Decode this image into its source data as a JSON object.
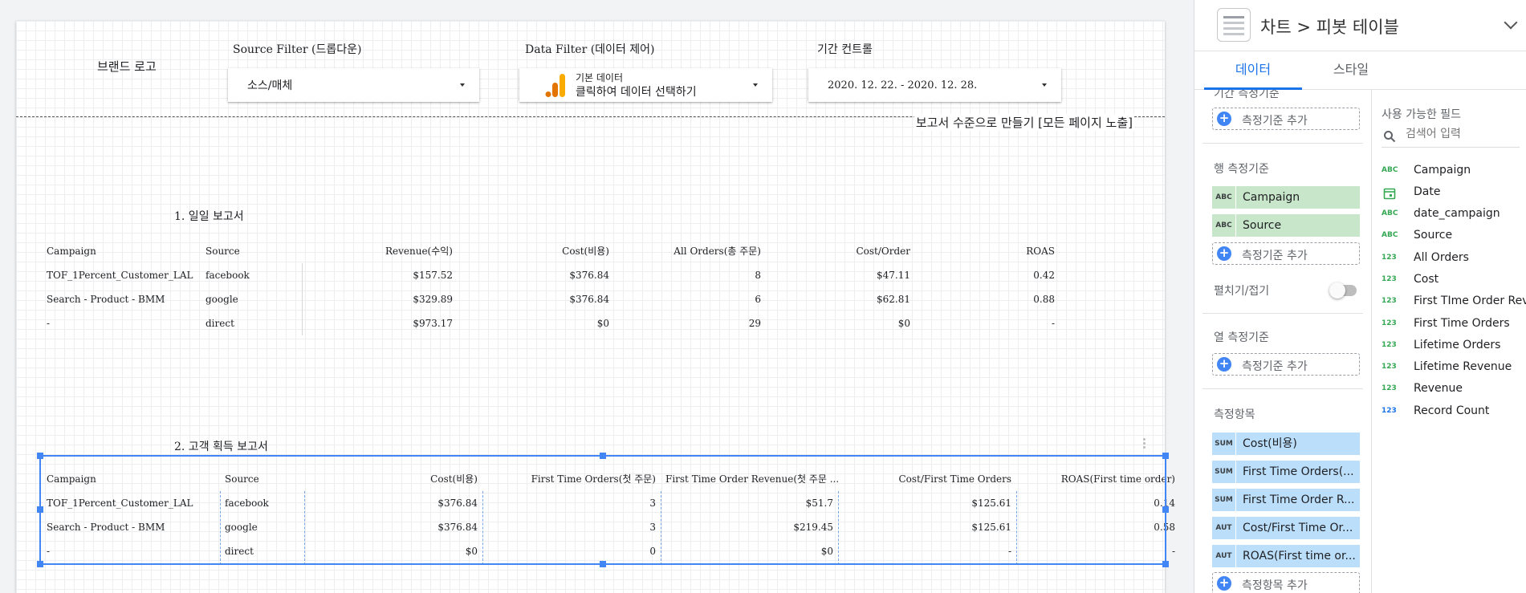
{
  "canvas": {
    "brand_logo": "브랜드 로고",
    "source_filter": {
      "title": "Source Filter (드롭다운)",
      "value": "소스/매체"
    },
    "data_filter": {
      "title": "Data Filter (데이터 제어)",
      "line1": "기본 데이터",
      "line2": "클릭하여 데이터 선택하기"
    },
    "date_control": {
      "title": "기간 컨트롤",
      "value": "2020. 12. 22. - 2020. 12. 28."
    },
    "report_level_note": "보고서 수준으로 만들기 [모든 페이지 노출]",
    "table1": {
      "title": "1. 일일 보고서",
      "columns": [
        "Campaign",
        "Source",
        "Revenue(수익)",
        "Cost(비용)",
        "All Orders(총 주문)",
        "Cost/Order",
        "ROAS"
      ],
      "rows": [
        [
          "TOF_1Percent_Customer_LAL",
          "facebook",
          "$157.52",
          "$376.84",
          "8",
          "$47.11",
          "0.42"
        ],
        [
          "Search - Product - BMM",
          "google",
          "$329.89",
          "$376.84",
          "6",
          "$62.81",
          "0.88"
        ],
        [
          "-",
          "direct",
          "$973.17",
          "$0",
          "29",
          "$0",
          "-"
        ]
      ]
    },
    "table2": {
      "title": "2. 고객 획득 보고서",
      "columns": [
        "Campaign",
        "Source",
        "Cost(비용)",
        "First Time Orders(첫 주문)",
        "First Time Order Revenue(첫 주문 ...",
        "Cost/First Time Orders",
        "ROAS(First time order)"
      ],
      "rows": [
        [
          "TOF_1Percent_Customer_LAL",
          "facebook",
          "$376.84",
          "3",
          "$51.7",
          "$125.61",
          "0.14"
        ],
        [
          "Search - Product - BMM",
          "google",
          "$376.84",
          "3",
          "$219.45",
          "$125.61",
          "0.58"
        ],
        [
          "-",
          "direct",
          "$0",
          "0",
          "$0",
          "-",
          "-"
        ]
      ]
    }
  },
  "panel": {
    "header_title": "차트 > 피봇 테이블",
    "tabs": [
      "데이터",
      "스타일"
    ],
    "period_dimension": {
      "heading": "기간 측정기준",
      "add_label": "측정기준 추가"
    },
    "row_dimensions": {
      "heading": "행 측정기준",
      "chips": [
        {
          "badge": "ABC",
          "name": "Campaign"
        },
        {
          "badge": "ABC",
          "name": "Source"
        }
      ],
      "add_label": "측정기준 추가"
    },
    "expand_collapse": {
      "label": "펼치기/접기",
      "enabled": false
    },
    "column_dimensions": {
      "heading": "열 측정기준",
      "add_label": "측정기준 추가"
    },
    "metrics": {
      "heading": "측정항목",
      "chips": [
        {
          "badge": "SUM",
          "name": "Cost(비용)"
        },
        {
          "badge": "SUM",
          "name": "First Time Orders(..."
        },
        {
          "badge": "SUM",
          "name": "First Time Order R..."
        },
        {
          "badge": "AUT",
          "name": "Cost/First Time Or..."
        },
        {
          "badge": "AUT",
          "name": "ROAS(First time or..."
        }
      ],
      "add_label": "측정항목 추가"
    },
    "available_fields": {
      "heading": "사용 가능한 필드",
      "search_placeholder": "검색어 입력",
      "fields": [
        {
          "type": "ABC",
          "name": "Campaign"
        },
        {
          "type": "date",
          "name": "Date"
        },
        {
          "type": "ABC",
          "name": "date_campaign"
        },
        {
          "type": "ABC",
          "name": "Source"
        },
        {
          "type": "123",
          "name": "All Orders"
        },
        {
          "type": "123",
          "name": "Cost"
        },
        {
          "type": "123",
          "name": "First TIme Order Reve..."
        },
        {
          "type": "123",
          "name": "First Time Orders"
        },
        {
          "type": "123",
          "name": "Lifetime Orders"
        },
        {
          "type": "123",
          "name": "Lifetime Revenue"
        },
        {
          "type": "123",
          "name": "Revenue"
        },
        {
          "type": "123",
          "name": "Record Count"
        }
      ]
    }
  },
  "colors": {
    "accent": "#1a73e8",
    "selection": "#4285f4",
    "dimension_chip": "#c8e6c9",
    "metric_chip": "#bbdefb",
    "ga_orange": "#f9ab00",
    "ga_orange_dark": "#e37400"
  }
}
